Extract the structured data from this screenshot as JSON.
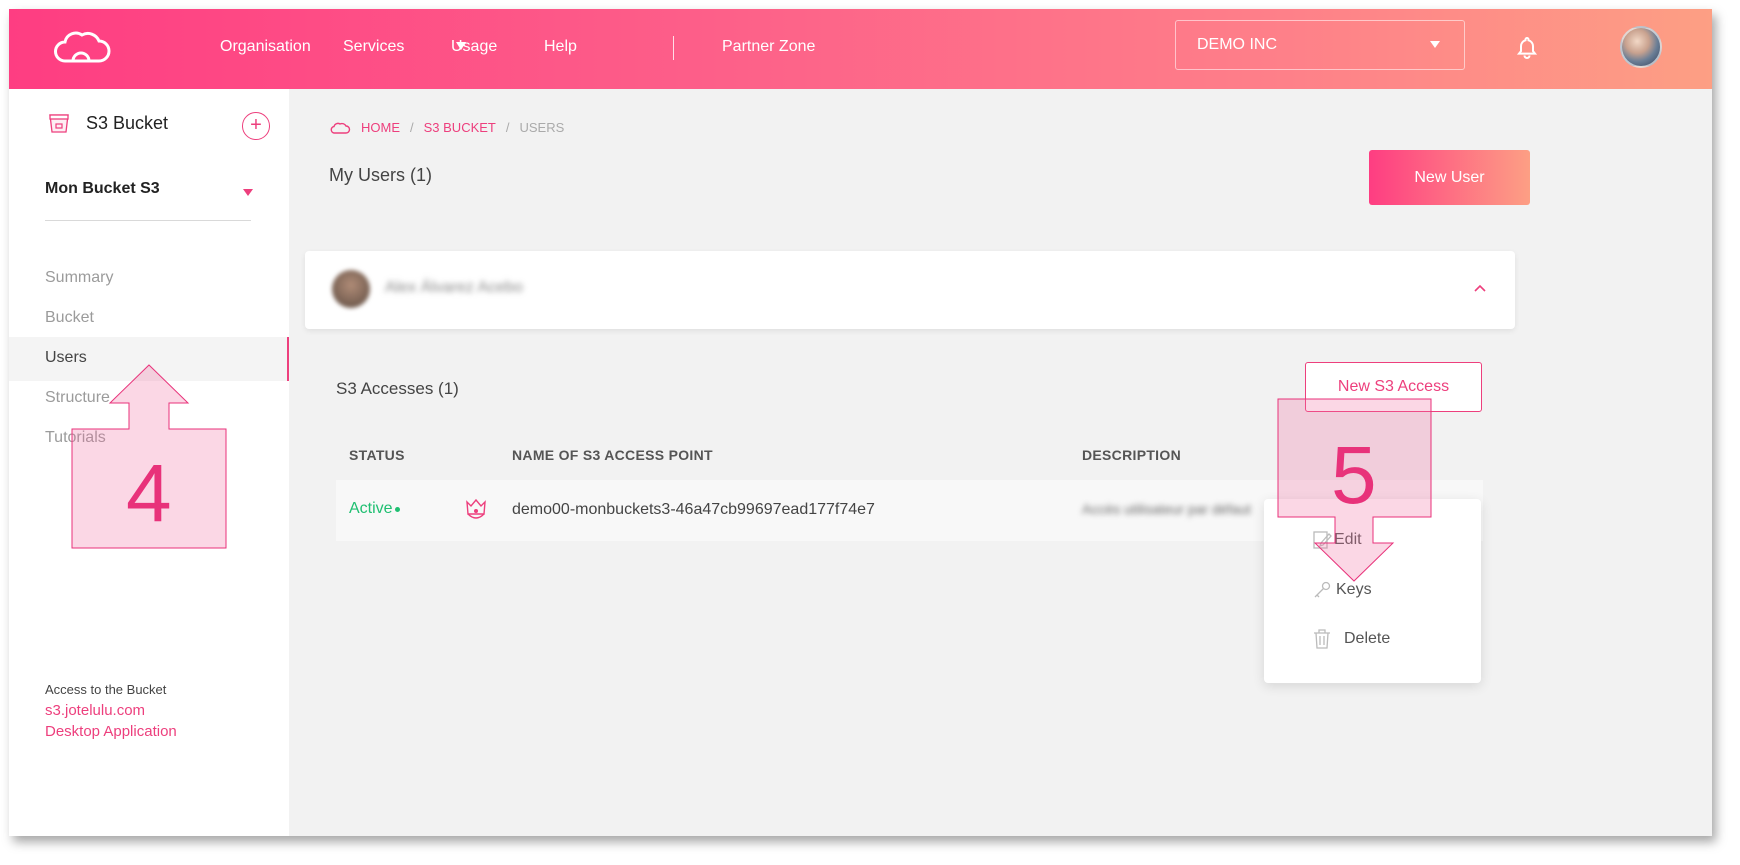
{
  "header": {
    "nav": [
      "Organisation",
      "Services",
      "Usage",
      "Help",
      "Partner Zone"
    ],
    "org_select": "DEMO INC"
  },
  "sidebar": {
    "title": "S3 Bucket",
    "add_label": "+",
    "bucket_select": "Mon Bucket S3",
    "items": [
      "Summary",
      "Bucket",
      "Users",
      "Structure",
      "Tutorials"
    ],
    "active_item": "Users",
    "footer": {
      "label": "Access to the Bucket",
      "link1": "s3.jotelulu.com",
      "link2": "Desktop Application"
    }
  },
  "breadcrumb": {
    "home": "HOME",
    "bucket": "S3 BUCKET",
    "current": "USERS",
    "sep": "/"
  },
  "page": {
    "title": "My Users (1)",
    "new_user_btn": "New User"
  },
  "user_card": {
    "name": "Alex Álvarez Acebo"
  },
  "accesses": {
    "title": "S3 Accesses (1)",
    "new_btn": "New S3 Access",
    "columns": [
      "STATUS",
      "NAME OF S3 ACCESS POINT",
      "DESCRIPTION"
    ],
    "rows": [
      {
        "status": "Active",
        "name": "demo00-monbuckets3-46a47cb99697ead177f74e7",
        "description": "Accès utilisateur par défaut"
      }
    ]
  },
  "context_menu": {
    "items": [
      "Edit",
      "Keys",
      "Delete"
    ]
  },
  "annotations": {
    "step4": "4",
    "step5": "5"
  },
  "colors": {
    "accent": "#ed3f7d",
    "gradient_start": "#fe3d82",
    "gradient_end": "#fd9f84",
    "active_status": "#1fbf71"
  },
  "icons": [
    "cloud-logo-icon",
    "bell-icon",
    "bucket-icon",
    "plus-icon",
    "home-cloud-icon",
    "chevron-up-icon",
    "crown-icon",
    "edit-icon",
    "key-icon",
    "trash-icon",
    "arrow-up-annotation",
    "arrow-down-annotation"
  ]
}
